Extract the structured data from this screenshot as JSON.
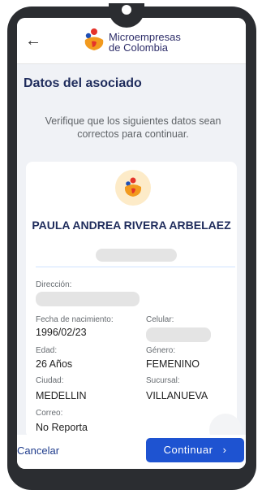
{
  "header": {
    "logo_text_line1": "Microempresas",
    "logo_text_line2": "de Colombia",
    "back_icon": "arrow-left-icon"
  },
  "page": {
    "title": "Datos del asociado",
    "subtitle": "Verifique que los siguientes datos sean correctos para continuar."
  },
  "profile": {
    "name": "PAULA ANDREA RIVERA ARBELAEZ"
  },
  "fields": {
    "address_label": "Dirección:",
    "birth_label": "Fecha de nacimiento:",
    "birth_value": "1996/02/23",
    "phone_label": "Celular:",
    "age_label": "Edad:",
    "age_value": "26 Años",
    "gender_label": "Género:",
    "gender_value": "FEMENINO",
    "city_label": "Ciudad:",
    "city_value": "MEDELLIN",
    "branch_label": "Sucursal:",
    "branch_value": "VILLANUEVA",
    "email_label": "Correo:",
    "email_value": "No Reporta"
  },
  "actions": {
    "cancel_label": "Cancelar",
    "continue_label": "Continuar",
    "continue_icon": "chevron-right-icon"
  },
  "colors": {
    "brand_navy": "#1f2c5c",
    "primary_button": "#1e53d1",
    "logo_red": "#e5332a",
    "logo_orange": "#f29a1e",
    "logo_blue": "#1f4fb4"
  }
}
